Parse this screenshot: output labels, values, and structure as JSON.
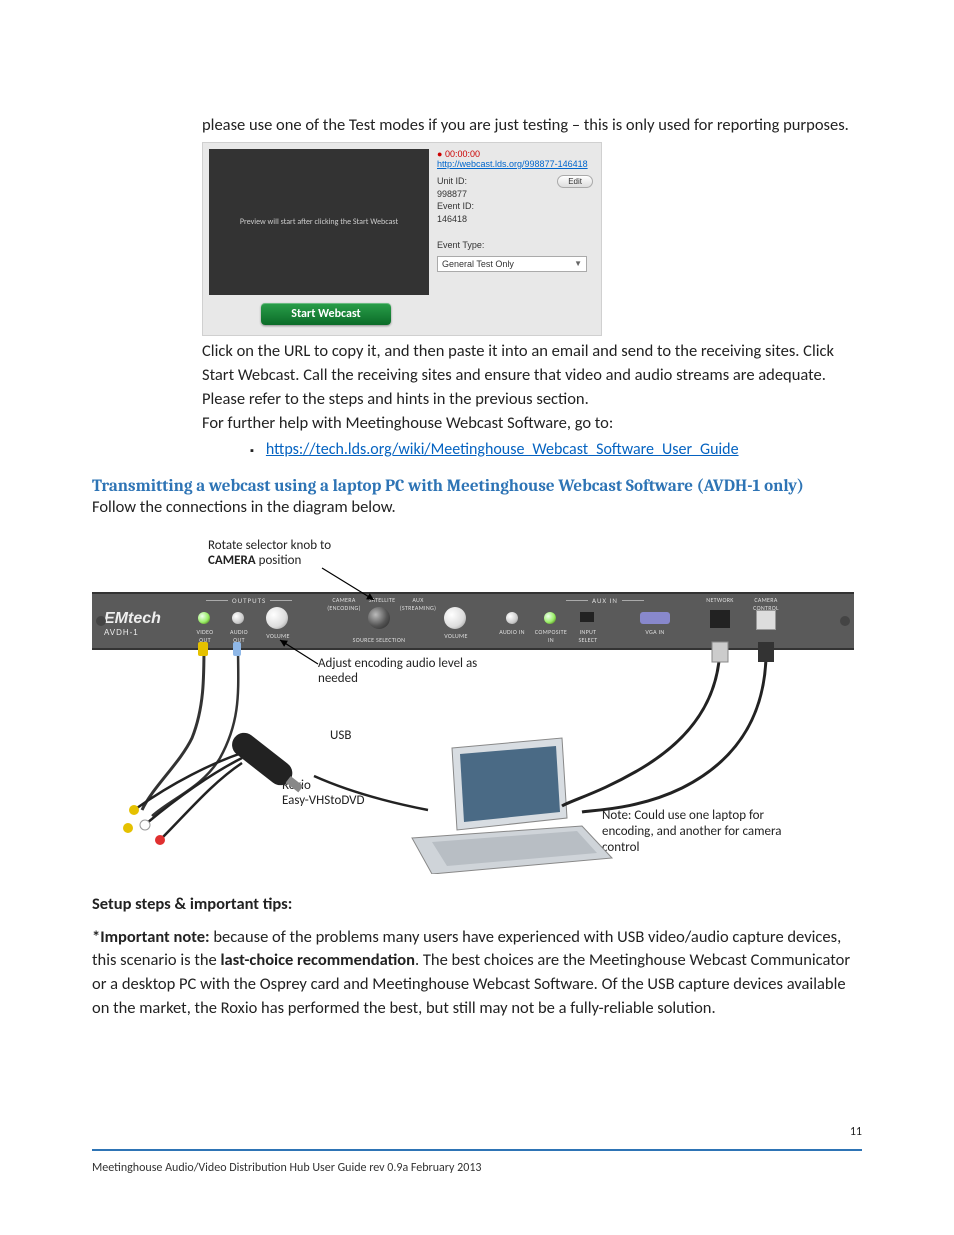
{
  "intro": "please use one of the Test modes if you are just testing – this is only used for reporting purposes.",
  "screenshot": {
    "preview_text": "Preview will start after clicking the Start Webcast",
    "timer": "00:00:00",
    "url": "http://webcast.lds.org/998877-146418",
    "unit_label": "Unit ID:",
    "unit_value": "998877",
    "event_label": "Event ID:",
    "event_value": "146418",
    "edit": "Edit",
    "event_type_label": "Event Type:",
    "event_type_value": "General Test Only",
    "start_btn": "Start Webcast"
  },
  "after1": "Click on the URL to copy it, and then paste it into an email and send to the receiving sites. Click Start Webcast. Call the receiving sites and ensure that video and audio streams are adequate.",
  "after2": "Please refer to the steps and hints in the previous section.",
  "after3": "For further help with Meetinghouse Webcast Software, go to:",
  "help_link": "https://tech.lds.org/wiki/Meetinghouse_Webcast_Software_User_Guide",
  "section_heading": "Transmitting a webcast using a laptop PC with Meetinghouse Webcast Software (AVDH-1 only)",
  "follow": "Follow the connections in the diagram below.",
  "diagram": {
    "rotate1": "Rotate selector knob to",
    "rotate2": "CAMERA",
    "rotate3": " position",
    "brand": "EMtech",
    "brand_sub": "AVDH-1",
    "group_outputs": "OUTPUTS",
    "group_auxin": "AUX IN",
    "lbl_video_out": "VIDEO OUT",
    "lbl_audio_out": "AUDIO OUT",
    "lbl_volume_l": "VOLUME",
    "lbl_src_sel": "SOURCE SELECTION",
    "lbl_camera": "CAMERA (ENCODING)",
    "lbl_satellite": "SATELLITE",
    "lbl_aux": "AUX (STREAMING)",
    "lbl_volume_r": "VOLUME",
    "lbl_audio_in": "AUDIO IN",
    "lbl_comp_in": "COMPOSITE IN",
    "lbl_input_sel": "INPUT SELECT",
    "lbl_vga": "VGA IN",
    "lbl_network": "NETWORK",
    "lbl_camctrl": "CAMERA CONTROL",
    "anno_adjust": "Adjust encoding audio level as needed",
    "anno_usb": "USB",
    "anno_roxio1": "Roxio",
    "anno_roxio2": "Easy-VHStoDVD",
    "anno_note": "Note:  Could use one laptop for encoding, and another for camera control"
  },
  "setup_heading": "Setup steps & important tips:",
  "note_bold1": "*Important note:",
  "note_text1": " because of the problems many users have experienced with USB video/audio capture devices, this scenario is the ",
  "note_bold2": "last-choice recommendation",
  "note_text2": ". The best choices are the Meetinghouse Webcast Communicator or a desktop PC with the Osprey card and Meetinghouse Webcast Software. Of the USB capture devices available on the market, the Roxio has performed the best, but still may not be a fully-reliable solution.",
  "footer": "Meetinghouse Audio/Video Distribution Hub User Guide rev 0.9a February 2013",
  "page_number": "11"
}
